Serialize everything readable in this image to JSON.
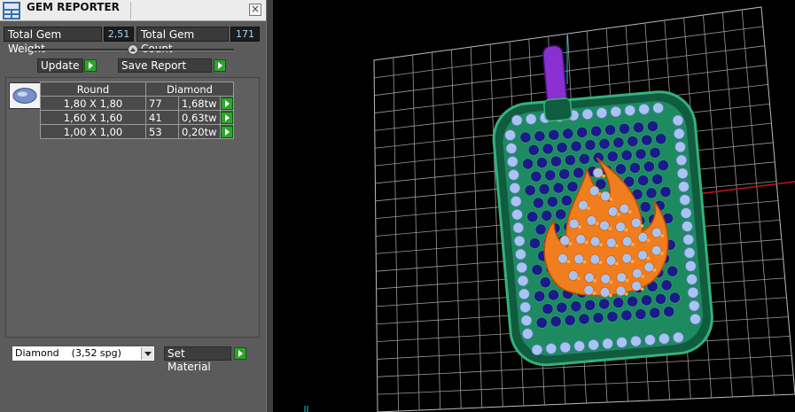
{
  "window": {
    "title": "GEM REPORTER",
    "close_label": "×"
  },
  "stats": {
    "weight_label": "Total Gem Weight",
    "weight_value": "2,51",
    "count_label": "Total Gem Count",
    "count_value": "171"
  },
  "actions": {
    "update_label": "Update",
    "save_label": "Save Report"
  },
  "table": {
    "headers": [
      "Round",
      "Diamond"
    ],
    "rows": [
      {
        "size": "1,80 X 1,80",
        "count": "77",
        "weight": "1,68tw"
      },
      {
        "size": "1,60 X 1,60",
        "count": "41",
        "weight": "0,63tw"
      },
      {
        "size": "1,00 X 1,00",
        "count": "53",
        "weight": "0,20tw"
      }
    ]
  },
  "material": {
    "selected": "Diamond    (3,52 spg)",
    "set_label": "Set Material"
  },
  "colors": {
    "grid": "#c8c8c8",
    "pendant_metal": "#1e8a60",
    "stone_light": "#a9c4f2",
    "stone_dark": "#1a1a88",
    "flame": "#f07d1e",
    "bail": "#8a2fd0"
  }
}
